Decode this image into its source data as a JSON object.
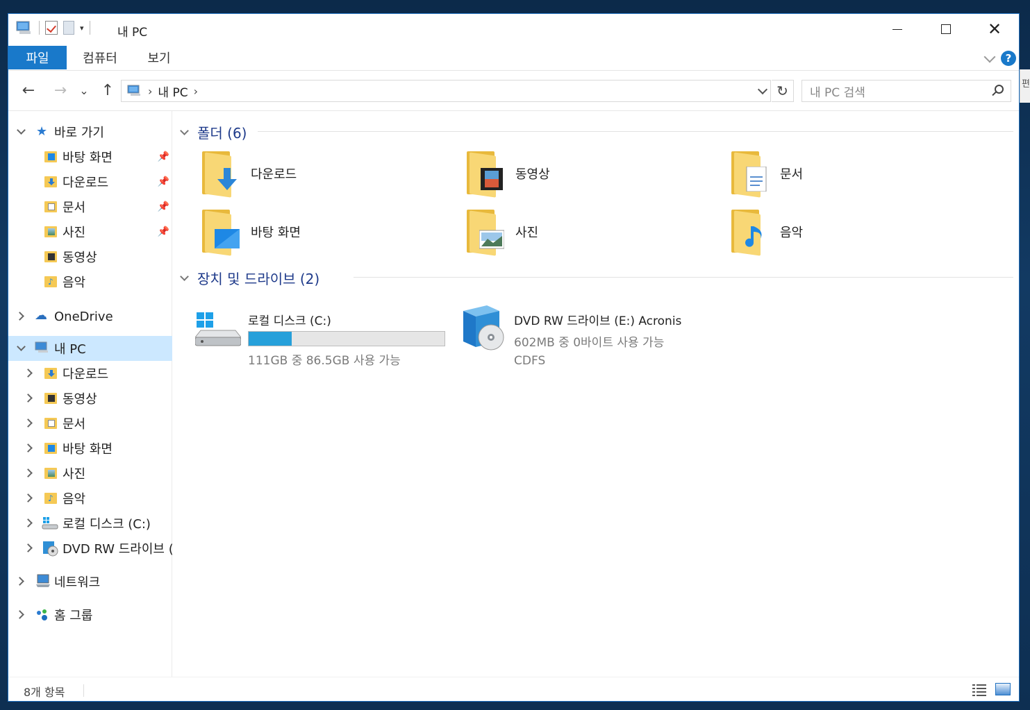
{
  "window": {
    "title": "내 PC",
    "buttons": {
      "minimize": "minimize",
      "maximize": "maximize",
      "close": "close"
    }
  },
  "ribbon": {
    "tabs": [
      {
        "label": "파일",
        "active": true
      },
      {
        "label": "컴퓨터",
        "active": false
      },
      {
        "label": "보기",
        "active": false
      }
    ],
    "help_label": "?"
  },
  "navigation": {
    "back_icon": "←",
    "forward_icon": "→",
    "recent_icon": "⌄",
    "up_icon": "↑",
    "breadcrumb": [
      "내 PC"
    ],
    "refresh_icon": "↻",
    "search_placeholder": "내 PC 검색"
  },
  "sidebar": {
    "quick_access": {
      "label": "바로 가기",
      "items": [
        {
          "label": "바탕 화면",
          "pinned": true
        },
        {
          "label": "다운로드",
          "pinned": true
        },
        {
          "label": "문서",
          "pinned": true
        },
        {
          "label": "사진",
          "pinned": true
        },
        {
          "label": "동영상",
          "pinned": false
        },
        {
          "label": "음악",
          "pinned": false
        }
      ]
    },
    "onedrive": {
      "label": "OneDrive"
    },
    "this_pc": {
      "label": "내 PC",
      "items": [
        {
          "label": "다운로드"
        },
        {
          "label": "동영상"
        },
        {
          "label": "문서"
        },
        {
          "label": "바탕 화면"
        },
        {
          "label": "사진"
        },
        {
          "label": "음악"
        },
        {
          "label": "로컬 디스크 (C:)"
        },
        {
          "label": "DVD RW 드라이브 ("
        }
      ]
    },
    "network": {
      "label": "네트워크"
    },
    "homegroup": {
      "label": "홈 그룹"
    }
  },
  "content": {
    "folders_group": {
      "label": "폴더 (6)"
    },
    "folders": [
      {
        "label": "다운로드",
        "icon": "download-arrow-icon"
      },
      {
        "label": "동영상",
        "icon": "film-icon"
      },
      {
        "label": "문서",
        "icon": "document-icon"
      },
      {
        "label": "바탕 화면",
        "icon": "desktop-icon"
      },
      {
        "label": "사진",
        "icon": "picture-icon"
      },
      {
        "label": "음악",
        "icon": "music-note-icon"
      }
    ],
    "drives_group": {
      "label": "장치 및 드라이브 (2)"
    },
    "drives": [
      {
        "name": "로컬 디스크 (C:)",
        "usage": "111GB 중 86.5GB 사용 가능",
        "used_fraction": 0.22
      },
      {
        "name": "DVD RW 드라이브 (E:) Acronis",
        "usage": "602MB 중 0바이트 사용 가능",
        "filesystem": "CDFS"
      }
    ]
  },
  "status": {
    "item_count": "8개 항목"
  },
  "colors": {
    "accent": "#1979ca",
    "selection": "#cce8ff",
    "folder": "#f8d775",
    "drive_fill": "#26a0da"
  }
}
